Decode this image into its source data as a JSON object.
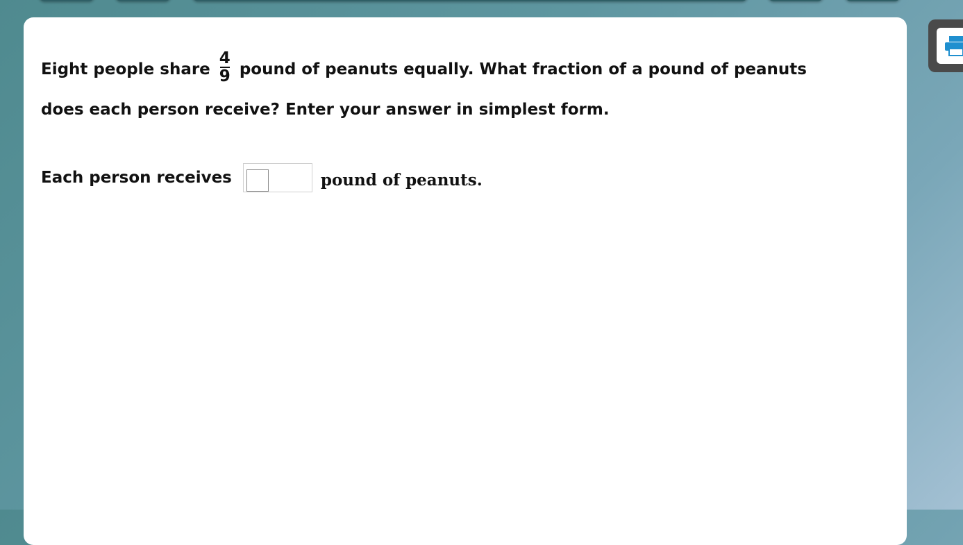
{
  "question": {
    "text_before": "Eight people share",
    "fraction": {
      "numerator": "4",
      "denominator": "9"
    },
    "text_after_line1": "pound of peanuts equally. What fraction of a pound of peanuts",
    "text_line2": "does each person receive? Enter your answer in simplest form."
  },
  "answer": {
    "label": "Each person receives",
    "value": "",
    "suffix": "pound of peanuts."
  },
  "toolbar": {
    "icon": "printer-icon",
    "accent_color": "#1f8fcf"
  }
}
